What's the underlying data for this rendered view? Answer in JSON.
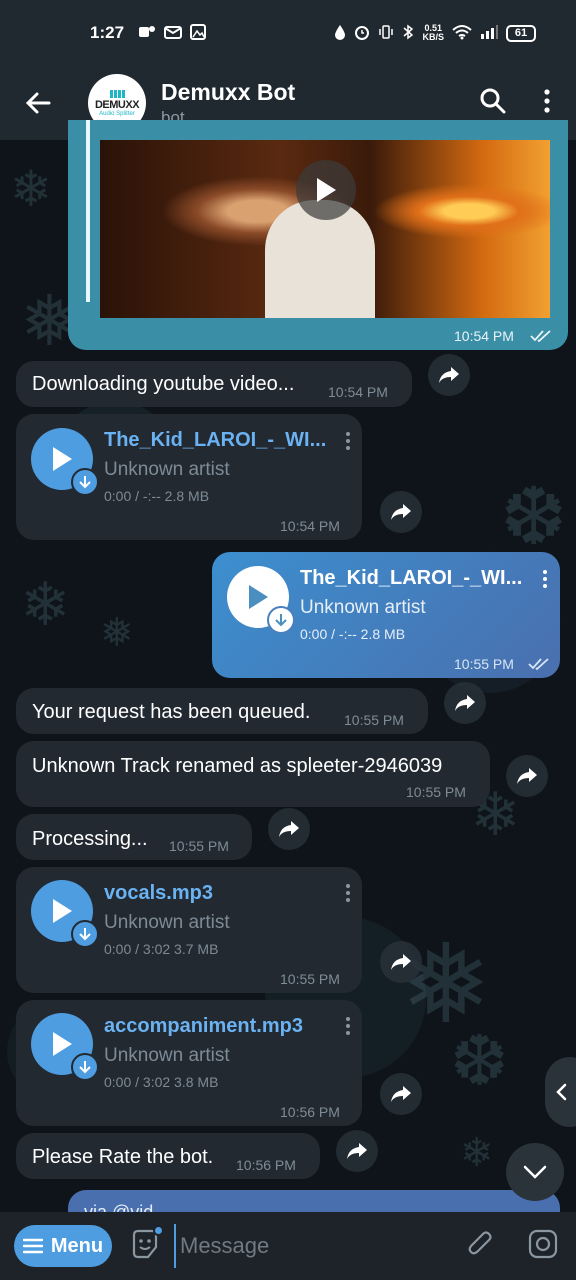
{
  "status_bar": {
    "time": "1:27",
    "net_speed_value": "0.51",
    "net_speed_unit": "KB/S",
    "battery": "61"
  },
  "header": {
    "title": "Demuxx Bot",
    "subtitle": "bot",
    "avatar_logo_text": "DEMUXX",
    "avatar_logo_subtext": "Audio Splitter"
  },
  "messages": {
    "video": {
      "time": "10:54 PM"
    },
    "downloading": {
      "text": "Downloading youtube video...",
      "time": "10:54 PM"
    },
    "audio1": {
      "title": "The_Kid_LAROI_-_WI...",
      "artist": "Unknown artist",
      "meta": "0:00 / -:--  2.8 MB",
      "time": "10:54 PM"
    },
    "audio2": {
      "title": "The_Kid_LAROI_-_WI...",
      "artist": "Unknown artist",
      "meta": "0:00 / -:--  2.8 MB",
      "time": "10:55 PM"
    },
    "queued": {
      "text": "Your request has been queued.",
      "time": "10:55 PM"
    },
    "renamed": {
      "text": "Unknown Track renamed as spleeter-2946039",
      "time": "10:55 PM"
    },
    "processing": {
      "text": "Processing...",
      "time": "10:55 PM"
    },
    "vocals": {
      "title": "vocals.mp3",
      "artist": "Unknown artist",
      "meta": "0:00 / 3:02  3.7 MB",
      "time": "10:55 PM"
    },
    "accompaniment": {
      "title": "accompaniment.mp3",
      "artist": "Unknown artist",
      "meta": "0:00 / 3:02  3.8 MB",
      "time": "10:56 PM"
    },
    "rate": {
      "text": "Please Rate the bot.",
      "time": "10:56 PM"
    },
    "via": {
      "text": "via @vid"
    }
  },
  "input_bar": {
    "menu_label": "Menu",
    "placeholder": "Message"
  },
  "colors": {
    "accent": "#4d9de0",
    "header_bg": "#212930",
    "incoming_bubble": "#222931",
    "outgoing_bubble": "#4a7fbe"
  }
}
